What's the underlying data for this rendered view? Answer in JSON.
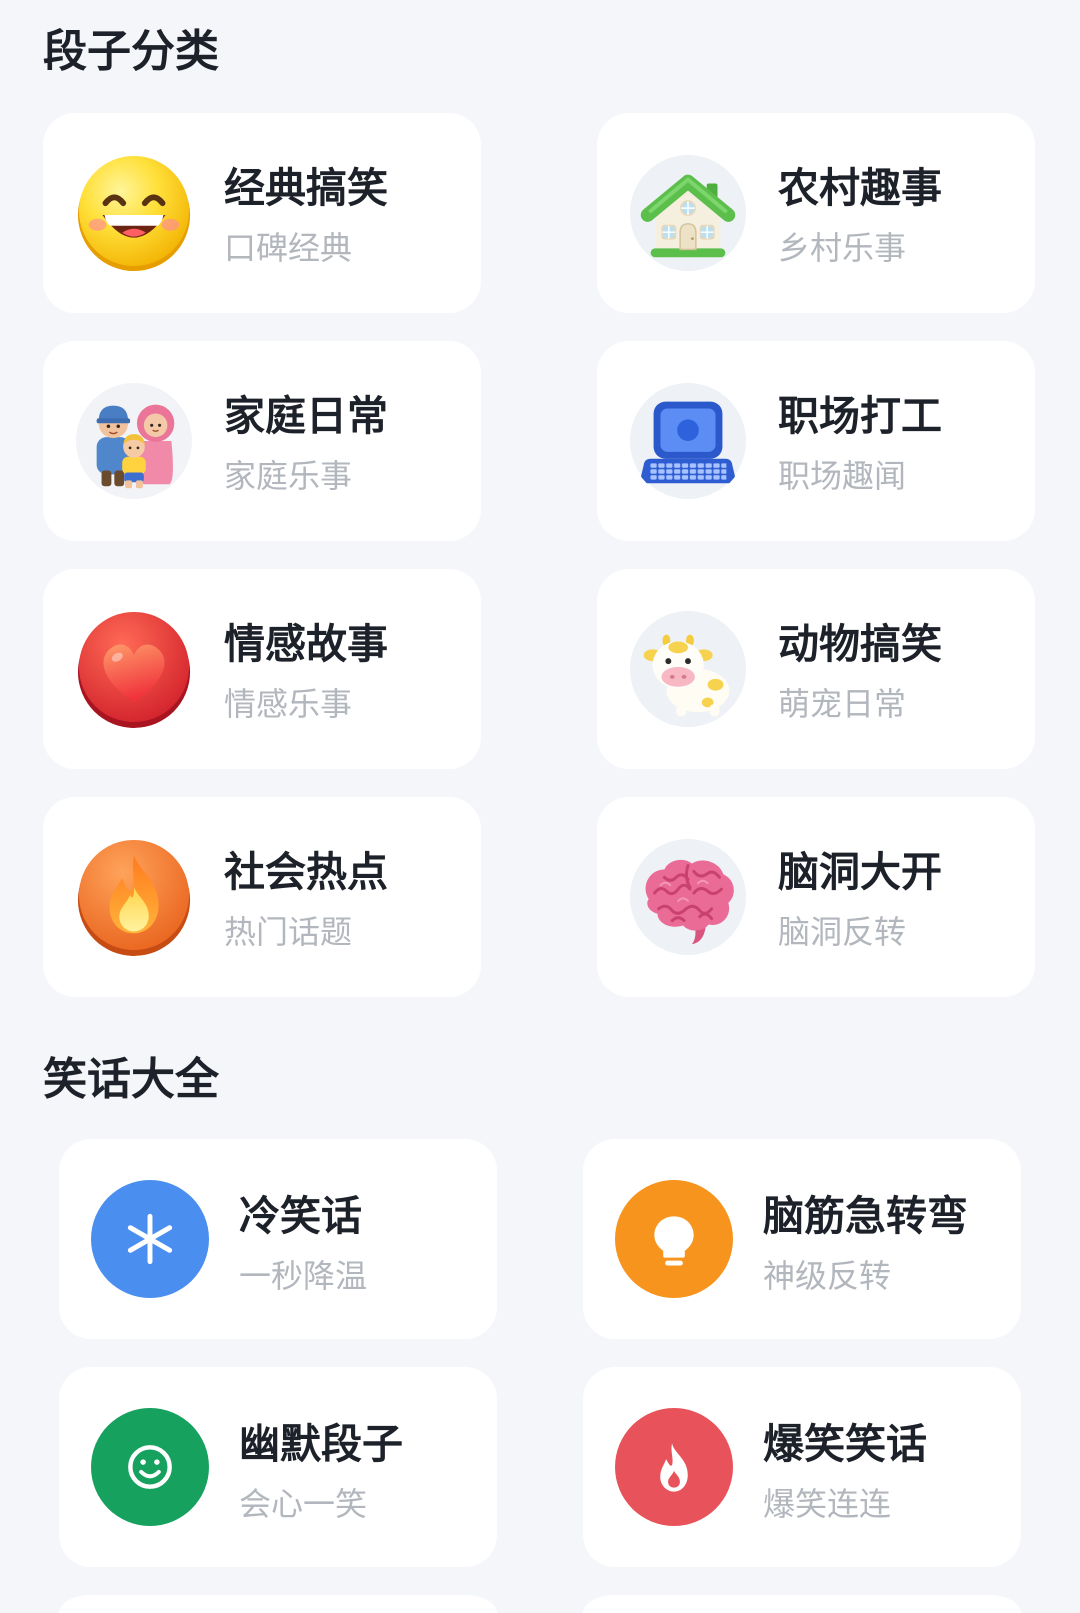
{
  "page": {
    "background": "#f4f6f9"
  },
  "sections": [
    {
      "title": "段子分类",
      "cards": [
        {
          "title": "经典搞笑",
          "subtitle": "口碑经典",
          "icon": "laughing-face-icon"
        },
        {
          "title": "农村趣事",
          "subtitle": "乡村乐事",
          "icon": "house-icon"
        },
        {
          "title": "家庭日常",
          "subtitle": "家庭乐事",
          "icon": "family-icon"
        },
        {
          "title": "职场打工",
          "subtitle": "职场趣闻",
          "icon": "laptop-icon"
        },
        {
          "title": "情感故事",
          "subtitle": "情感乐事",
          "icon": "heart-icon"
        },
        {
          "title": "动物搞笑",
          "subtitle": "萌宠日常",
          "icon": "cow-icon"
        },
        {
          "title": "社会热点",
          "subtitle": "热门话题",
          "icon": "fire-icon"
        },
        {
          "title": "脑洞大开",
          "subtitle": "脑洞反转",
          "icon": "brain-icon"
        }
      ]
    },
    {
      "title": "笑话大全",
      "cards": [
        {
          "title": "冷笑话",
          "subtitle": "一秒降温",
          "icon": "snowflake-icon",
          "color": "#4a8ef0"
        },
        {
          "title": "脑筋急转弯",
          "subtitle": "神级反转",
          "icon": "lightbulb-icon",
          "color": "#f7941d"
        },
        {
          "title": "幽默段子",
          "subtitle": "会心一笑",
          "icon": "smiley-icon",
          "color": "#17a15f"
        },
        {
          "title": "爆笑笑话",
          "subtitle": "爆笑连连",
          "icon": "flame-icon",
          "color": "#e8525a"
        }
      ]
    }
  ]
}
